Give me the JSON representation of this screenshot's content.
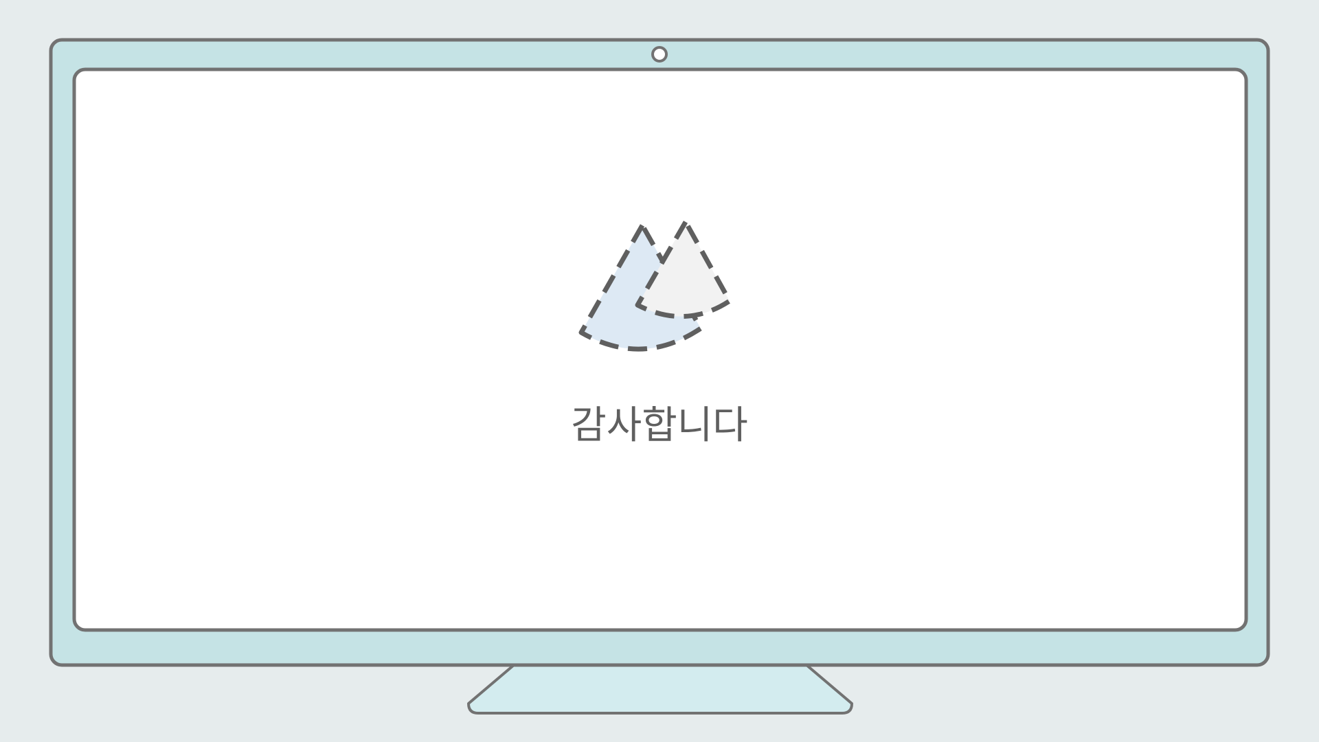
{
  "slide": {
    "caption": "감사합니다"
  },
  "colors": {
    "background": "#e6eced",
    "monitor_bezel": "#c5e3e5",
    "monitor_stand": "#d3ecef",
    "outline": "#727272",
    "screen": "#ffffff",
    "cone_left_fill": "#dde9f4",
    "cone_right_fill": "#f2f2f2",
    "dash_stroke": "#5f5f5f",
    "caption_text": "#5f5f5f"
  },
  "icons": {
    "hero": "two-dashed-cones-icon",
    "camera": "webcam-icon"
  }
}
